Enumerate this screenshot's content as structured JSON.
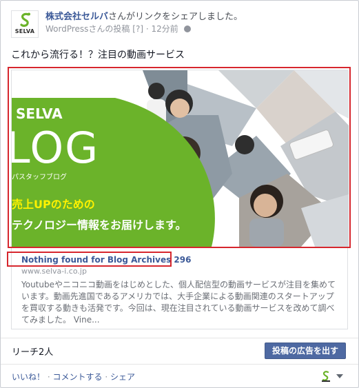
{
  "post": {
    "page_name": "株式会社セルバ",
    "action_text": "さんがリンクをシェアしました。",
    "via": "WordPressさんの投稿",
    "bracket": "[?]",
    "separator": "·",
    "time": "12分前",
    "message": "これから流行る！？注目の動画サービス"
  },
  "avatar": {
    "wordmark": "SELVA"
  },
  "hero": {
    "brand": "SELVA",
    "big_word": "LOG",
    "subtitle": "パスタッフブログ",
    "line1": "売上UPのための",
    "line2": "テクノロジー情報をお届けします。"
  },
  "link": {
    "title": "Nothing found for Blog Archives 296",
    "domain": "www.selva-i.co.jp",
    "description": "Youtubeやニコニコ動画をはじめとした、個人配信型の動画サービスが注目を集めています。動画先進国であるアメリカでは、大手企業による動画関連のスタートアップを買収する動きも活発です。今回は、現在注目されている動画サービスを改めて調べてみました。 Vine..."
  },
  "stats": {
    "reach": "リーチ2人",
    "boost_label": "投稿の広告を出す"
  },
  "actions": {
    "like": "いいね！",
    "comment": "コメントする",
    "share": "シェア",
    "dot": "·"
  },
  "colors": {
    "fb_blue": "#3b5998",
    "brand_green": "#6bb32a",
    "boost": "#4e69a2",
    "highlight_red": "#d6262d"
  }
}
